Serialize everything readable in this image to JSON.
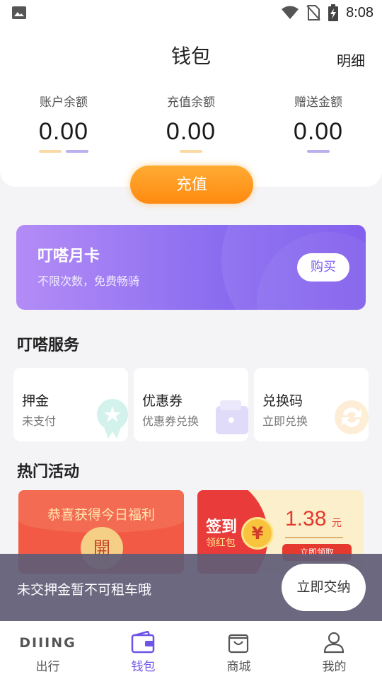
{
  "status_bar": {
    "time": "8:08"
  },
  "header": {
    "title": "钱包",
    "detail_link": "明细"
  },
  "balances": [
    {
      "label": "账户余额",
      "amount": "0.00"
    },
    {
      "label": "充值余额",
      "amount": "0.00"
    },
    {
      "label": "赠送金额",
      "amount": "0.00"
    }
  ],
  "recharge_label": "充值",
  "month_card": {
    "title": "叮嗒月卡",
    "subtitle": "不限次数，免费畅骑",
    "buy_label": "购买"
  },
  "services": {
    "title": "叮嗒服务",
    "items": [
      {
        "title": "押金",
        "subtitle": "未支付",
        "icon": "medal-icon"
      },
      {
        "title": "优惠券",
        "subtitle": "优惠券兑换",
        "icon": "wallet-icon"
      },
      {
        "title": "兑换码",
        "subtitle": "立即兑换",
        "icon": "exchange-icon"
      }
    ]
  },
  "activities": {
    "title": "热门活动",
    "red_packet": {
      "text": "恭喜获得今日福利",
      "open_label": "開"
    },
    "sign_in": {
      "sign_text": "签到",
      "sub_text": "领红包",
      "yen": "¥",
      "amount": "1.38",
      "unit": "元",
      "get_label": "立即领取"
    }
  },
  "notice": {
    "message": "未交押金暂不可租车哦",
    "button_label": "立即交纳"
  },
  "nav": {
    "brand": "DIIING",
    "items": [
      {
        "label": "出行",
        "active": false
      },
      {
        "label": "钱包",
        "active": true
      },
      {
        "label": "商城",
        "active": false
      },
      {
        "label": "我的",
        "active": false
      }
    ]
  },
  "colors": {
    "accent": "#6f53e6",
    "orange": "#ff9a1f",
    "red": "#e5382e"
  }
}
